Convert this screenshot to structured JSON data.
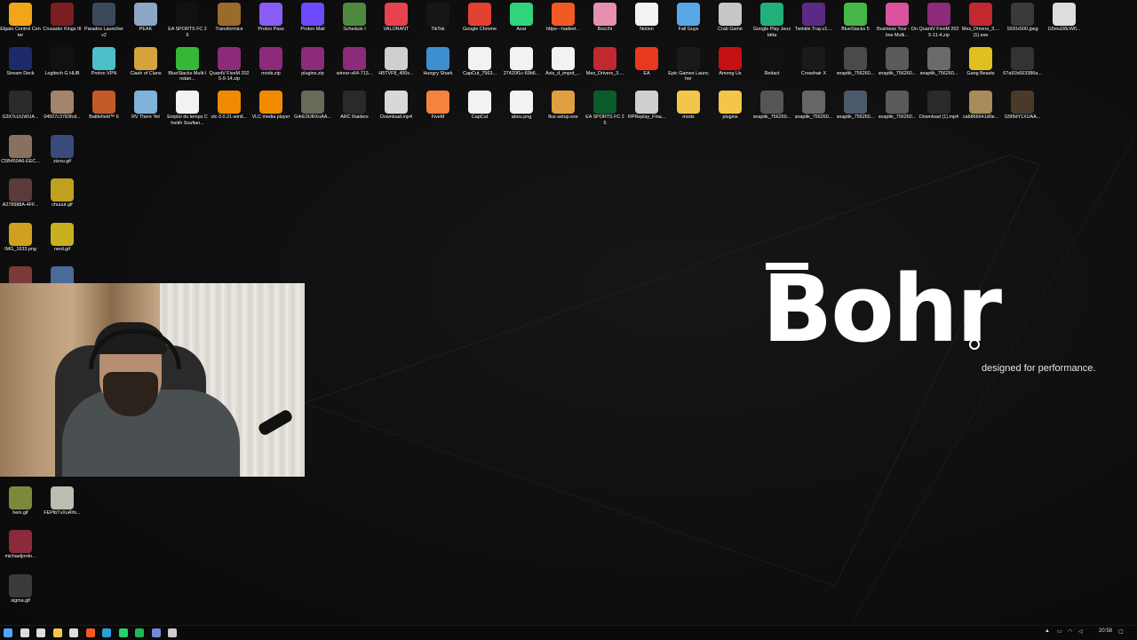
{
  "brand": {
    "name": "Bohr",
    "tagline": "designed for performance."
  },
  "desktop_icons": [
    {
      "label": "Elgato Control Center",
      "icon": "elgato-icon",
      "color": "#f2a51a",
      "col": 0,
      "row": 0
    },
    {
      "label": "Crusader Kings III",
      "icon": "crusader-kings-icon",
      "color": "#7a1e22",
      "col": 1,
      "row": 0
    },
    {
      "label": "Paradox Launcher v2",
      "icon": "paradox-icon",
      "color": "#3b4a5a",
      "col": 2,
      "row": 0
    },
    {
      "label": "PEAK",
      "icon": "peak-icon",
      "color": "#8ea6c8",
      "col": 3,
      "row": 0
    },
    {
      "label": "EA SPORTS FC 26",
      "icon": "fc26-icon",
      "color": "#111111",
      "col": 4,
      "row": 0
    },
    {
      "label": "Transformice",
      "icon": "transformice-icon",
      "color": "#9a6b2d",
      "col": 5,
      "row": 0
    },
    {
      "label": "Proton Pass",
      "icon": "proton-pass-icon",
      "color": "#8a5cf6",
      "col": 6,
      "row": 0
    },
    {
      "label": "Proton Mail",
      "icon": "proton-mail-icon",
      "color": "#6d4aff",
      "col": 7,
      "row": 0
    },
    {
      "label": "Schedule I",
      "icon": "schedule-icon",
      "color": "#4d8a3f",
      "col": 8,
      "row": 0
    },
    {
      "label": "VALORANT",
      "icon": "valorant-icon",
      "color": "#e8424f",
      "col": 9,
      "row": 0
    },
    {
      "label": "TikTok",
      "icon": "tiktok-icon",
      "color": "#161616",
      "col": 10,
      "row": 0
    },
    {
      "label": "Google Chrome",
      "icon": "chrome-icon",
      "color": "#e34133",
      "col": 11,
      "row": 0
    },
    {
      "label": "Azar",
      "icon": "azar-icon",
      "color": "#2fd47c",
      "col": 12,
      "row": 0
    },
    {
      "label": "https---hadeet...",
      "icon": "brave-icon",
      "color": "#f15a22",
      "col": 13,
      "row": 0
    },
    {
      "label": "Bocchi",
      "icon": "bocchi-icon",
      "color": "#e78fb0",
      "col": 14,
      "row": 0
    },
    {
      "label": "Notion",
      "icon": "notion-icon",
      "color": "#f2f2f2",
      "col": 15,
      "row": 0
    },
    {
      "label": "Fall Guys",
      "icon": "fall-guys-icon",
      "color": "#5aa7e8",
      "col": 16,
      "row": 0
    },
    {
      "label": "Crab Game",
      "icon": "crab-game-icon",
      "color": "#c7c7c7",
      "col": 17,
      "row": 0
    },
    {
      "label": "Google Play Jeux bêta",
      "icon": "google-play-icon",
      "color": "#21b07a",
      "col": 18,
      "row": 0
    },
    {
      "label": "Twinkle.Tray.v1....",
      "icon": "twinkle-tray-icon",
      "color": "#5b2a86",
      "col": 19,
      "row": 0
    },
    {
      "label": "BlueStacks 5",
      "icon": "bluestacks-icon",
      "color": "#46b648",
      "col": 20,
      "row": 0
    },
    {
      "label": "Business Tour - Online Multi...",
      "icon": "business-tour-icon",
      "color": "#d9539e",
      "col": 21,
      "row": 0
    },
    {
      "label": "QuantV FiveM 2025-11-4.zip",
      "icon": "winrar-icon",
      "color": "#8b2b7a",
      "col": 22,
      "row": 0
    },
    {
      "label": "Mes_Drivers_3.... (1).exe",
      "icon": "drivers-icon",
      "color": "#c2282f",
      "col": 23,
      "row": 0
    },
    {
      "label": "1500x500.jpeg",
      "icon": "image-file-icon",
      "color": "#3a3a3a",
      "col": 24,
      "row": 0
    },
    {
      "label": "G5muD8cW0...",
      "icon": "image-file-icon",
      "color": "#dddddd",
      "col": 25,
      "row": 0
    },
    {
      "label": "Stream Deck",
      "icon": "stream-deck-icon",
      "color": "#1f2a6b",
      "col": 0,
      "row": 1
    },
    {
      "label": "Logitech G HUB",
      "icon": "logitech-icon",
      "color": "#111111",
      "col": 1,
      "row": 1
    },
    {
      "label": "Proton VPN",
      "icon": "proton-vpn-icon",
      "color": "#4bc0c8",
      "col": 2,
      "row": 1
    },
    {
      "label": "Clash of Clans",
      "icon": "clash-icon",
      "color": "#d6a23b",
      "col": 3,
      "row": 1
    },
    {
      "label": "BlueStacks Multi-Instan...",
      "icon": "bluestacks-multi-icon",
      "color": "#35b837",
      "col": 4,
      "row": 1
    },
    {
      "label": "QuantV FiveM 2025-9-14.zip",
      "icon": "winrar-icon",
      "color": "#8b2b7a",
      "col": 5,
      "row": 1
    },
    {
      "label": "mods.zip",
      "icon": "winrar-icon",
      "color": "#8b2b7a",
      "col": 6,
      "row": 1
    },
    {
      "label": "plugins.zip",
      "icon": "winrar-icon",
      "color": "#8b2b7a",
      "col": 7,
      "row": 1
    },
    {
      "label": "winrar-x64-713...",
      "icon": "winrar-icon",
      "color": "#8b2b7a",
      "col": 8,
      "row": 1
    },
    {
      "label": "H5TVF8_400x...",
      "icon": "image-file-icon",
      "color": "#cfcfcf",
      "col": 9,
      "row": 1
    },
    {
      "label": "Hungry Shark",
      "icon": "hungry-shark-icon",
      "color": "#3d8fd1",
      "col": 10,
      "row": 1
    },
    {
      "label": "CapCut_7563...",
      "icon": "capcut-icon",
      "color": "#f2f2f2",
      "col": 11,
      "row": 1
    },
    {
      "label": "27420f1c-69b6...",
      "icon": "file-icon",
      "color": "#f2f2f2",
      "col": 12,
      "row": 1
    },
    {
      "label": "Avis_d_impot_...",
      "icon": "file-icon",
      "color": "#f2f2f2",
      "col": 13,
      "row": 1
    },
    {
      "label": "Mes_Drivers_3....",
      "icon": "drivers-icon",
      "color": "#c2282f",
      "col": 14,
      "row": 1
    },
    {
      "label": "EA",
      "icon": "ea-icon",
      "color": "#e8391f",
      "col": 15,
      "row": 1
    },
    {
      "label": "Epic Games Launcher",
      "icon": "epic-games-icon",
      "color": "#1a1a1a",
      "col": 16,
      "row": 1
    },
    {
      "label": "Among Us",
      "icon": "among-us-icon",
      "color": "#c51111",
      "col": 17,
      "row": 1
    },
    {
      "label": "Redact",
      "icon": "redact-icon",
      "color": "#111111",
      "col": 18,
      "row": 1
    },
    {
      "label": "Crosshair X",
      "icon": "crosshair-icon",
      "color": "#1a1a1a",
      "col": 19,
      "row": 1
    },
    {
      "label": "snaptik_756260...",
      "icon": "video-file-icon",
      "color": "#4a4a4a",
      "col": 20,
      "row": 1
    },
    {
      "label": "snaptik_756260...",
      "icon": "video-file-icon",
      "color": "#5a5a5a",
      "col": 21,
      "row": 1
    },
    {
      "label": "snaptik_756260...",
      "icon": "video-file-icon",
      "color": "#6a6a6a",
      "col": 22,
      "row": 1
    },
    {
      "label": "Gang Beasts",
      "icon": "gang-beasts-icon",
      "color": "#e0c020",
      "col": 23,
      "row": 1
    },
    {
      "label": "67a91b663386a...",
      "icon": "image-file-icon",
      "color": "#333333",
      "col": 24,
      "row": 1
    },
    {
      "label": "G3XTcUUWUA...",
      "icon": "image-file-icon",
      "color": "#2b2b2b",
      "col": 0,
      "row": 2
    },
    {
      "label": "04507c3783fcd...",
      "icon": "image-file-icon",
      "color": "#a3836a",
      "col": 1,
      "row": 2
    },
    {
      "label": "Battlefield™ 6",
      "icon": "battlefield-icon",
      "color": "#c25a2a",
      "col": 2,
      "row": 2
    },
    {
      "label": "RV There Yet",
      "icon": "rv-there-yet-icon",
      "color": "#7fb3d9",
      "col": 3,
      "row": 2
    },
    {
      "label": "Emploi du temps Cheikh Soufian...",
      "icon": "file-icon",
      "color": "#f2f2f2",
      "col": 4,
      "row": 2
    },
    {
      "label": "vlc-3.0.21-win6...",
      "icon": "vlc-icon",
      "color": "#f08a00",
      "col": 5,
      "row": 2
    },
    {
      "label": "VLC media player",
      "icon": "vlc-icon",
      "color": "#f08a00",
      "col": 6,
      "row": 2
    },
    {
      "label": "G4rE0URXoAA...",
      "icon": "image-file-icon",
      "color": "#6a6a5a",
      "col": 7,
      "row": 2
    },
    {
      "label": "ARC Raiders",
      "icon": "arc-raiders-icon",
      "color": "#2a2a2a",
      "col": 8,
      "row": 2
    },
    {
      "label": "Download.mp4",
      "icon": "video-file-icon",
      "color": "#d8d8d8",
      "col": 9,
      "row": 2
    },
    {
      "label": "FiveM",
      "icon": "fivem-icon",
      "color": "#f4833c",
      "col": 10,
      "row": 2
    },
    {
      "label": "CapCut",
      "icon": "capcut-icon",
      "color": "#f2f2f2",
      "col": 11,
      "row": 2
    },
    {
      "label": "abou.png",
      "icon": "image-file-icon",
      "color": "#f2f2f2",
      "col": 12,
      "row": 2
    },
    {
      "label": "flux-setup.exe",
      "icon": "flux-icon",
      "color": "#e0a040",
      "col": 13,
      "row": 2
    },
    {
      "label": "EA SPORTS FC 25",
      "icon": "fc25-icon",
      "color": "#0a5c2a",
      "col": 14,
      "row": 2
    },
    {
      "label": "RPReplay_Fina...",
      "icon": "video-file-icon",
      "color": "#cfcfcf",
      "col": 15,
      "row": 2
    },
    {
      "label": "mods",
      "icon": "folder-icon",
      "color": "#f3c64a",
      "col": 16,
      "row": 2
    },
    {
      "label": "plugins",
      "icon": "folder-icon",
      "color": "#f3c64a",
      "col": 17,
      "row": 2
    },
    {
      "label": "snaptik_756260...",
      "icon": "video-file-icon",
      "color": "#555555",
      "col": 18,
      "row": 2
    },
    {
      "label": "snaptik_756260...",
      "icon": "video-file-icon",
      "color": "#666666",
      "col": 19,
      "row": 2
    },
    {
      "label": "snaptik_756260...",
      "icon": "video-file-icon",
      "color": "#4b5a6a",
      "col": 20,
      "row": 2
    },
    {
      "label": "snaptik_756260...",
      "icon": "video-file-icon",
      "color": "#5a5a5a",
      "col": 21,
      "row": 2
    },
    {
      "label": "Download (1).mp4",
      "icon": "video-file-icon",
      "color": "#2a2a2a",
      "col": 22,
      "row": 2
    },
    {
      "label": "ca6866641d0e...",
      "icon": "image-file-icon",
      "color": "#a98a5a",
      "col": 23,
      "row": 2
    },
    {
      "label": "G5f9dY1XUAA...",
      "icon": "image-file-icon",
      "color": "#4a3a2a",
      "col": 24,
      "row": 2
    },
    {
      "label": "C5B450A6-EEC...",
      "icon": "image-file-icon",
      "color": "#8a7060",
      "col": 0,
      "row": 3
    },
    {
      "label": "zizou.gif",
      "icon": "gif-file-icon",
      "color": "#3a4a7a",
      "col": 1,
      "row": 3
    },
    {
      "label": "A278988A-4FF...",
      "icon": "image-file-icon",
      "color": "#5a3a3a",
      "col": 0,
      "row": 4
    },
    {
      "label": "chuuut.gif",
      "icon": "gif-file-icon",
      "color": "#c0a020",
      "col": 1,
      "row": 4
    },
    {
      "label": "IMG_1633.png",
      "icon": "image-file-icon",
      "color": "#d0a020",
      "col": 0,
      "row": 5
    },
    {
      "label": "nerd.gif",
      "icon": "gif-file-icon",
      "color": "#c8b020",
      "col": 1,
      "row": 5
    },
    {
      "label": "",
      "icon": "image-file-icon",
      "color": "#7a3a3a",
      "col": 0,
      "row": 6
    },
    {
      "label": "",
      "icon": "gif-file-icon",
      "color": "#4a6a9a",
      "col": 1,
      "row": 6
    },
    {
      "label": "hein.gif",
      "icon": "gif-file-icon",
      "color": "#7a8a3a",
      "col": 0,
      "row": 11
    },
    {
      "label": "FEPtbTvXoAYo...",
      "icon": "image-file-icon",
      "color": "#bcbcb0",
      "col": 1,
      "row": 11
    },
    {
      "label": "michaeljordo...",
      "icon": "gif-file-icon",
      "color": "#8a2a3a",
      "col": 0,
      "row": 12
    },
    {
      "label": "sigma.gif",
      "icon": "gif-file-icon",
      "color": "#3a3a3a",
      "col": 0,
      "row": 13
    }
  ],
  "taskbar": {
    "apps": [
      {
        "icon": "windows-start-icon",
        "color": "#4aa8ff"
      },
      {
        "icon": "search-icon",
        "color": "#dddddd"
      },
      {
        "icon": "task-view-icon",
        "color": "#dddddd"
      },
      {
        "icon": "file-explorer-icon",
        "color": "#f3c64a"
      },
      {
        "icon": "store-icon",
        "color": "#dddddd"
      },
      {
        "icon": "brave-icon",
        "color": "#f15a22"
      },
      {
        "icon": "edge-icon",
        "color": "#2a9fd8"
      },
      {
        "icon": "whatsapp-icon",
        "color": "#25d366"
      },
      {
        "icon": "spotify-icon",
        "color": "#1db954"
      },
      {
        "icon": "discord-icon",
        "color": "#7289da"
      },
      {
        "icon": "obs-icon",
        "color": "#cccccc"
      }
    ],
    "clock": "20:58"
  }
}
